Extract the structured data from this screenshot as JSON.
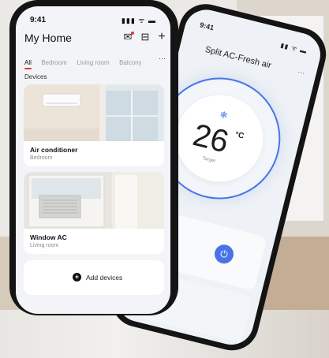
{
  "home": {
    "status_time": "9:41",
    "status_icons": "▮▮▮ ᯤ ▬",
    "title": "My Home",
    "tabs": [
      {
        "label": "All",
        "active": true
      },
      {
        "label": "Bedroom",
        "active": false
      },
      {
        "label": "Living room",
        "active": false
      },
      {
        "label": "Balcony",
        "active": false
      }
    ],
    "tabs_more": "···",
    "section": "Devices",
    "devices": [
      {
        "name": "Air conditioner",
        "room": "Bedroom",
        "image": "wall-split-ac-photo"
      },
      {
        "name": "Window AC",
        "room": "Living room",
        "image": "window-ac-photo"
      }
    ],
    "add_label": "Add devices",
    "icons": {
      "messages": "mail-icon",
      "scan": "scan-icon",
      "add": "plus-icon",
      "add_device": "plus-circle-icon"
    },
    "accent": "#e53935"
  },
  "device": {
    "status_time": "9:41",
    "status_icons": "▮▮ ᯤ ▬",
    "title": "Split AC-Fresh air",
    "more": "···",
    "mode_icon": "snowflake-icon",
    "temperature": "26",
    "unit": "°C",
    "target_label": "Target",
    "power_icon": "power-icon",
    "accent": "#4a73e8"
  }
}
